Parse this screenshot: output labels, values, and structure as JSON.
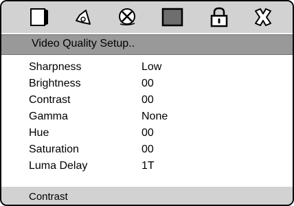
{
  "icon_bar": {
    "icons": [
      "tv-icon",
      "speaker-icon",
      "video-disc-icon",
      "square-window-icon",
      "padlock-icon",
      "exit-icon"
    ],
    "selected": "square-window-icon"
  },
  "title": "Video Quality Setup..",
  "settings": [
    {
      "label": "Sharpness",
      "value": "Low"
    },
    {
      "label": "Brightness",
      "value": "00"
    },
    {
      "label": "Contrast",
      "value": "00"
    },
    {
      "label": "Gamma",
      "value": "None"
    },
    {
      "label": "Hue",
      "value": "00"
    },
    {
      "label": "Saturation",
      "value": "00"
    },
    {
      "label": "Luma Delay",
      "value": "1T"
    }
  ],
  "status_text": "Contrast",
  "colors": {
    "panel": "#d2d2d2",
    "title_bar": "#999999",
    "selected_icon_fill": "#6e6e6e"
  }
}
